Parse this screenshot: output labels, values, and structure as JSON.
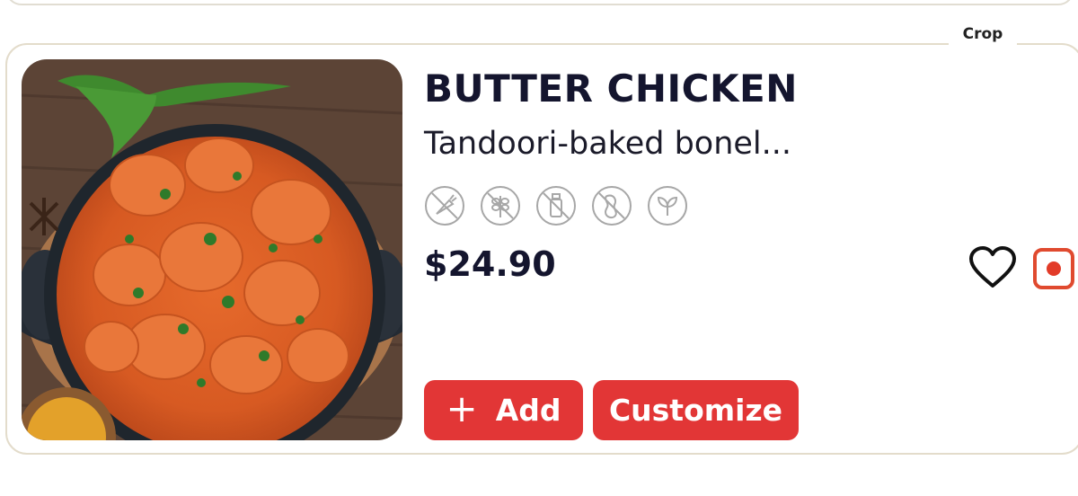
{
  "overlay": {
    "crop_label": "Crop"
  },
  "item": {
    "title": "BUTTER CHICKEN",
    "description": "Tandoori-baked bonel...",
    "price": "$24.90",
    "image": "butter-chicken-dish-image",
    "dietary_icons": [
      "no-carrot-icon",
      "no-gluten-icon",
      "no-dairy-icon",
      "no-peanut-icon",
      "vegan-leaf-icon"
    ]
  },
  "actions": {
    "add_label": "Add",
    "add_icon": "plus-icon",
    "customize_label": "Customize",
    "favorite_icon": "heart-icon",
    "record_icon": "record-icon"
  },
  "colors": {
    "accent": "#e23636",
    "title": "#14152e",
    "card_border": "#e3dccb",
    "icon_gray": "#a7a7a7",
    "record_red": "#e04a2f"
  }
}
